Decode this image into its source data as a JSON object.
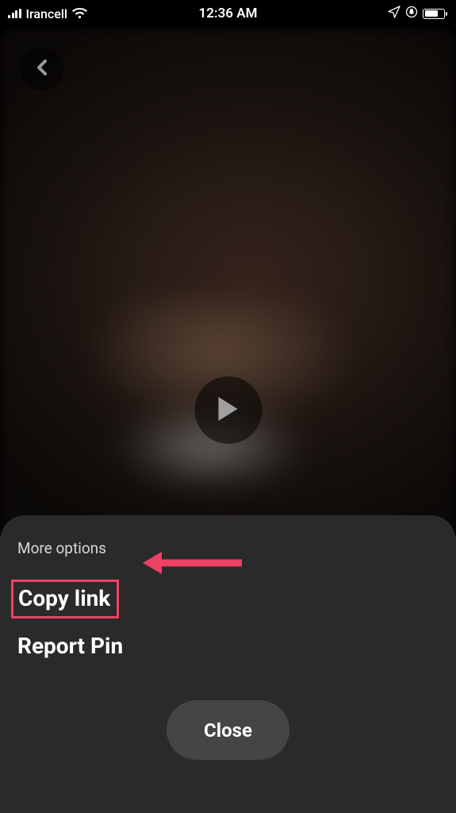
{
  "statusBar": {
    "carrier": "Irancell",
    "time": "12:36 AM"
  },
  "sheet": {
    "title": "More options",
    "items": [
      {
        "label": "Copy link",
        "highlighted": true
      },
      {
        "label": "Report Pin",
        "highlighted": false
      }
    ],
    "close": "Close"
  }
}
